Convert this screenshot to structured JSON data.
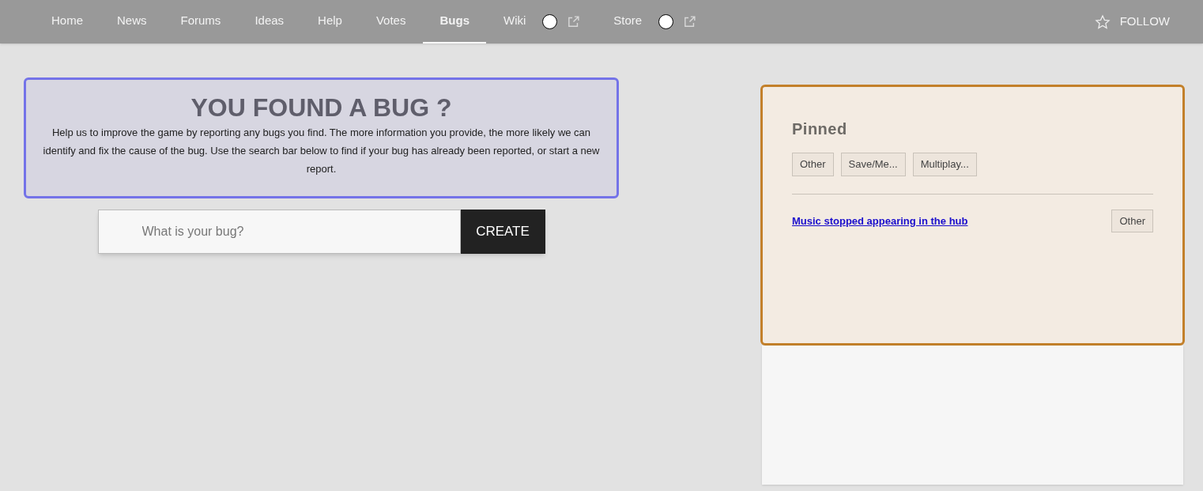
{
  "nav": {
    "items": [
      {
        "label": "Home",
        "selected": false,
        "kind": "link"
      },
      {
        "label": "News",
        "selected": false,
        "kind": "link"
      },
      {
        "label": "Forums",
        "selected": false,
        "kind": "link"
      },
      {
        "label": "Ideas",
        "selected": false,
        "kind": "link"
      },
      {
        "label": "Help",
        "selected": false,
        "kind": "link"
      },
      {
        "label": "Votes",
        "selected": false,
        "kind": "link"
      },
      {
        "label": "Bugs",
        "selected": true,
        "kind": "link"
      },
      {
        "label": "Wiki",
        "selected": false,
        "kind": "external"
      },
      {
        "label": "Store",
        "selected": false,
        "kind": "external"
      }
    ],
    "follow": "FOLLOW"
  },
  "intro": {
    "title": "YOU FOUND A BUG ?",
    "text": "Help us to improve the game by reporting any bugs you find. The more information you provide, the more likely we can identify and fix the cause of the bug. Use the search bar below to find if your bug has already been reported, or start a new report."
  },
  "search": {
    "placeholder": "What is your bug?",
    "button": "CREATE"
  },
  "pinned": {
    "title": "Pinned",
    "tags": [
      "Other",
      "Save/Me...",
      "Multiplay..."
    ],
    "posts": [
      {
        "title": "Music stopped appearing in the hub",
        "tag": "Other"
      }
    ]
  }
}
